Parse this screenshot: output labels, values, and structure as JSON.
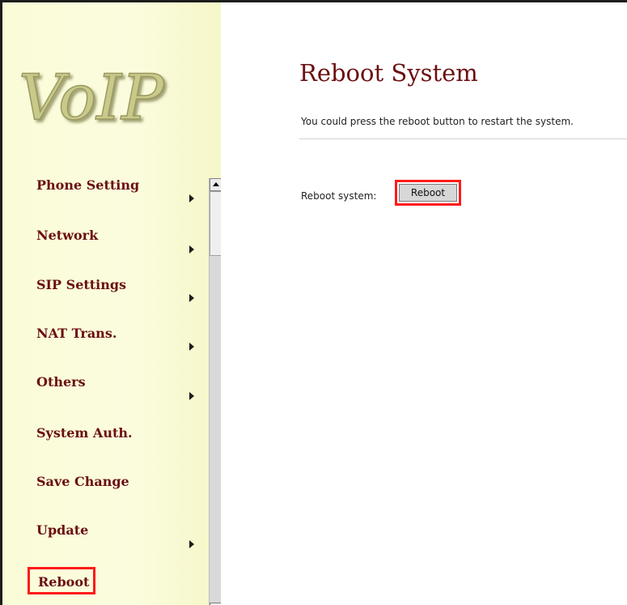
{
  "logo": {
    "text": "VoIP"
  },
  "menu": {
    "items": [
      {
        "label": "Phone Setting",
        "has_submenu": true
      },
      {
        "label": "Network",
        "has_submenu": true
      },
      {
        "label": "SIP Settings",
        "has_submenu": true
      },
      {
        "label": "NAT Trans.",
        "has_submenu": true
      },
      {
        "label": "Others",
        "has_submenu": true
      },
      {
        "label": "System Auth.",
        "has_submenu": false
      },
      {
        "label": "Save Change",
        "has_submenu": false
      },
      {
        "label": "Update",
        "has_submenu": true
      },
      {
        "label": "Reboot",
        "has_submenu": false,
        "highlighted": true
      }
    ]
  },
  "main": {
    "title": "Reboot System",
    "description": "You could press the reboot button to restart the system.",
    "reboot_label": "Reboot system:",
    "reboot_button": "Reboot"
  },
  "colors": {
    "sidebar_bg": "#fafcd8",
    "menu_text": "#6b0f10",
    "highlight_border": "#ff1a1a",
    "logo_fill": "#c9c98a"
  },
  "icons": {
    "submenu_arrow": "right-triangle",
    "scroll_up": "up-triangle"
  }
}
